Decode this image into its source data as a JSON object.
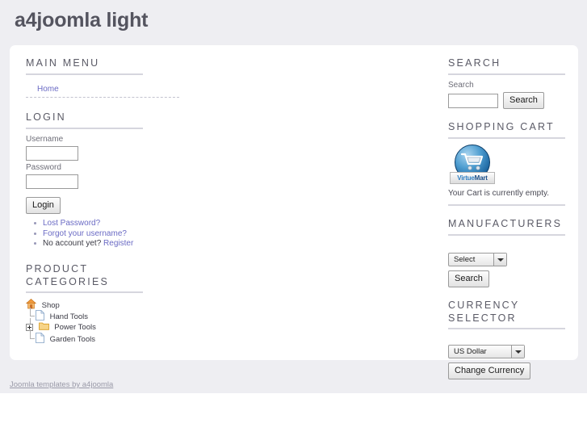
{
  "header": {
    "title": "a4joomla light"
  },
  "footer": {
    "credit_link": "Joomla templates by a4joomla"
  },
  "left": {
    "main_menu": {
      "title": "MAIN MENU",
      "items": [
        {
          "label": "Home"
        }
      ]
    },
    "login": {
      "title": "LOGIN",
      "username_label": "Username",
      "username_value": "",
      "password_label": "Password",
      "password_value": "",
      "submit_label": "Login",
      "links": [
        {
          "text": "Lost Password?",
          "link": true
        },
        {
          "text": "Forgot your username?",
          "link": true
        },
        {
          "prefix": "No account yet?",
          "text": "Register",
          "link": true
        }
      ]
    },
    "categories": {
      "title": "PRODUCT CATEGORIES",
      "tree": [
        {
          "label": "Shop",
          "icon": "house-icon",
          "level": 0,
          "expandable": false
        },
        {
          "label": "Hand Tools",
          "icon": "file-icon",
          "level": 1,
          "expandable": false
        },
        {
          "label": "Power Tools",
          "icon": "folder-icon",
          "level": 1,
          "expandable": true
        },
        {
          "label": "Garden Tools",
          "icon": "file-icon",
          "level": 1,
          "expandable": false
        }
      ]
    }
  },
  "right": {
    "search": {
      "title": "SEARCH",
      "label": "Search",
      "value": "",
      "button_label": "Search"
    },
    "cart": {
      "title": "SHOPPING CART",
      "logo_text_a": "Virtue",
      "logo_text_b": "Mart",
      "empty_text": "Your Cart is currently empty."
    },
    "manufacturers": {
      "title": "MANUFACTURERS",
      "selected": "Select",
      "options": [
        "Select"
      ],
      "button_label": "Search"
    },
    "currency": {
      "title": "CURRENCY SELECTOR",
      "selected": "US Dollar",
      "options": [
        "US Dollar"
      ],
      "button_label": "Change Currency"
    }
  },
  "colors": {
    "page_bg": "#eeeef2",
    "content_bg": "#ffffff",
    "heading": "#5a5a66",
    "rule": "#d6d6de",
    "link": "#6a6ac4",
    "title": "#54545f"
  }
}
